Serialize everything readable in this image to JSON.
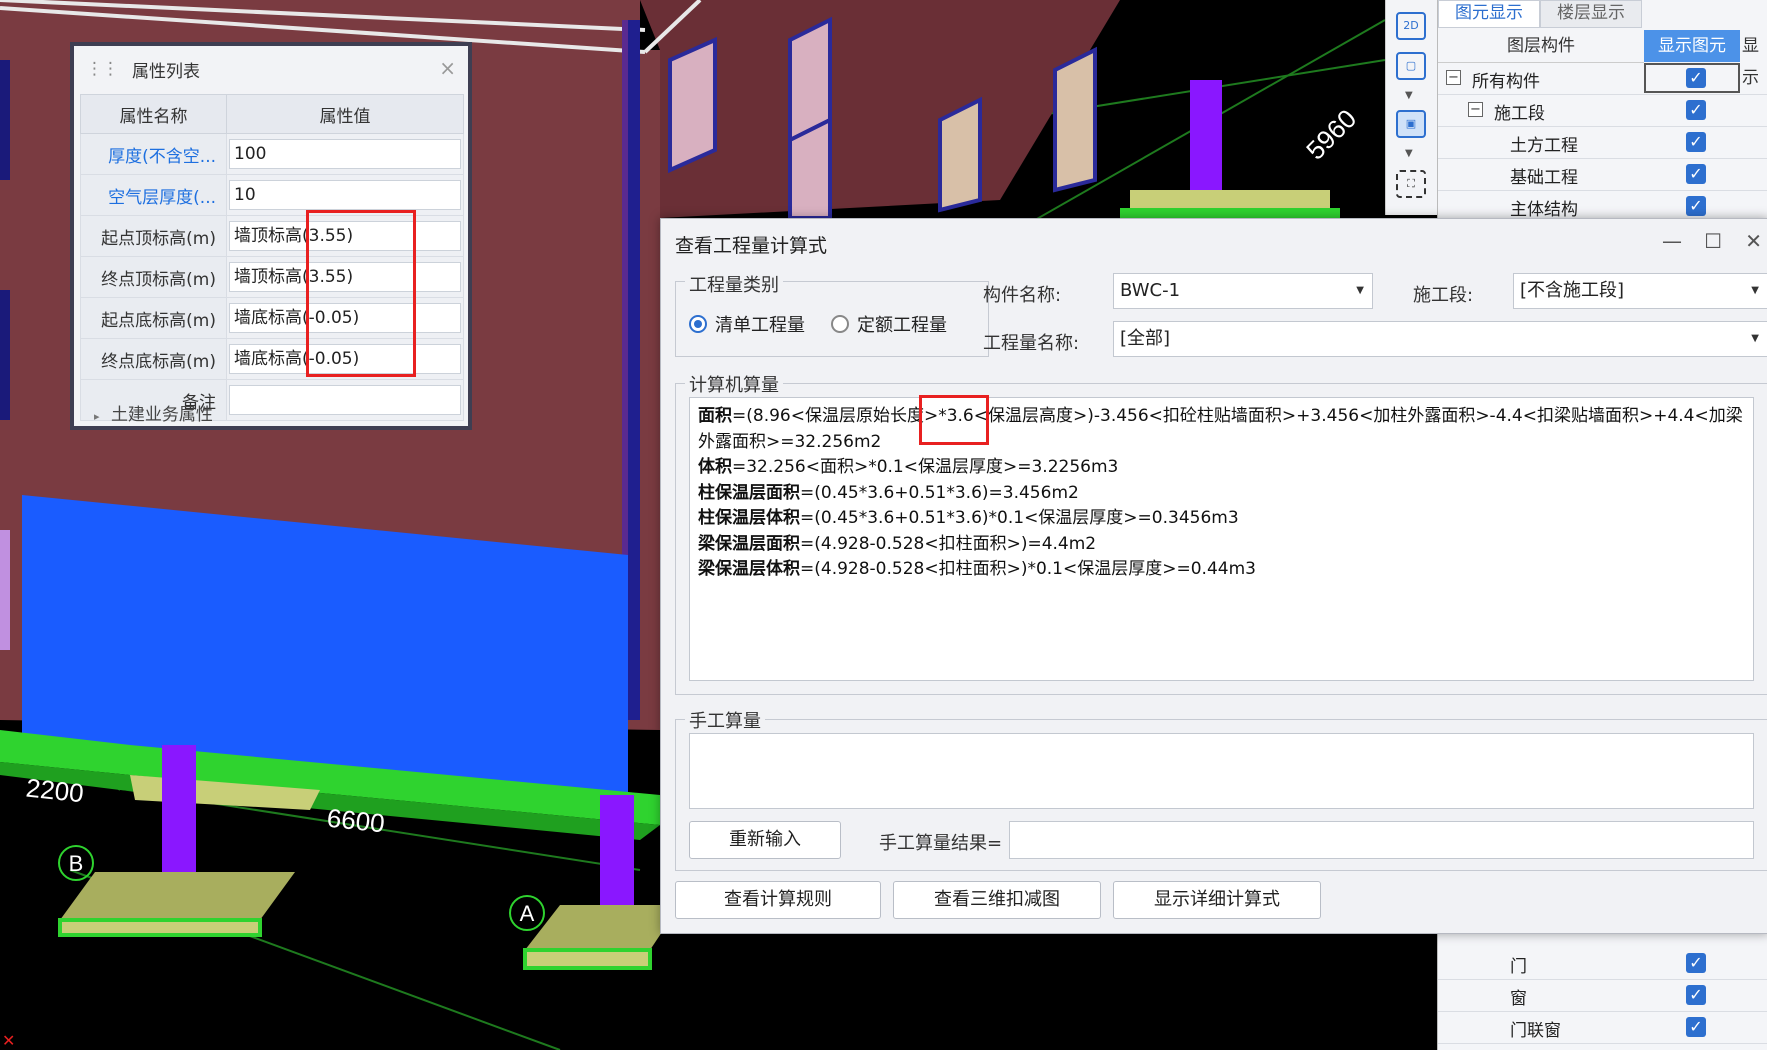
{
  "scene": {
    "dimensions": [
      "5960",
      "2200",
      "6600"
    ],
    "axis_labels": [
      "B",
      "A"
    ]
  },
  "property_panel": {
    "title": "属性列表",
    "close_glyph": "×",
    "header_name": "属性名称",
    "header_value": "属性值",
    "rows": [
      {
        "name": "厚度(不含空...",
        "value": "100"
      },
      {
        "name": "空气层厚度(...",
        "value": "10"
      },
      {
        "name": "起点顶标高(m)",
        "value": "墙顶标高(3.55)"
      },
      {
        "name": "终点顶标高(m)",
        "value": "墙顶标高(3.55)"
      },
      {
        "name": "起点底标高(m)",
        "value": "墙底标高(-0.05)"
      },
      {
        "name": "终点底标高(m)",
        "value": "墙底标高(-0.05)"
      },
      {
        "name": "备注",
        "value": ""
      }
    ],
    "footer_group": "土建业务属性",
    "blue_row_color": "#1d6fe0"
  },
  "toolstrip": {
    "tool_2d": "2D"
  },
  "layer_panel": {
    "tabs": [
      "图元显示",
      "楼层显示"
    ],
    "col_component": "图层构件",
    "col_show": "显示图元",
    "col_extra": "显示",
    "rows_top": [
      "所有构件",
      "施工段",
      "土方工程",
      "基础工程",
      "主体结构"
    ],
    "rows_bottom": [
      "门",
      "窗",
      "门联窗"
    ],
    "accent": "#4c92e8"
  },
  "dialog": {
    "title": "查看工程量计算式",
    "group_category": "工程量类别",
    "radio_list": "清单工程量",
    "radio_quota": "定额工程量",
    "label_component": "构件名称:",
    "component_value": "BWC-1",
    "label_stage": "施工段:",
    "stage_value": "[不含施工段]",
    "label_qty_name": "工程量名称:",
    "qty_name_value": "[全部]",
    "group_computer": "计算机算量",
    "formulas": [
      {
        "label": "面积",
        "expr": "=(8.96<保温层原始长度>*3.6<保温层高度>)-3.456<扣砼柱贴墙面积>+3.456<加柱外露面积>-4.4<扣梁贴墙面积>+4.4<加梁外露面积>=32.256m2"
      },
      {
        "label": "体积",
        "expr": "=32.256<面积>*0.1<保温层厚度>=3.2256m3"
      },
      {
        "label": "柱保温层面积",
        "expr": "=(0.45*3.6+0.51*3.6)=3.456m2"
      },
      {
        "label": "柱保温层体积",
        "expr": "=(0.45*3.6+0.51*3.6)*0.1<保温层厚度>=0.3456m3"
      },
      {
        "label": "梁保温层面积",
        "expr": "=(4.928-0.528<扣柱面积>)=4.4m2"
      },
      {
        "label": "梁保温层体积",
        "expr": "=(4.928-0.528<扣柱面积>)*0.1<保温层厚度>=0.44m3"
      }
    ],
    "group_manual": "手工算量",
    "btn_reenter": "重新输入",
    "label_manual_result": "手工算量结果=",
    "btn_rules": "查看计算规则",
    "btn_3d": "查看三维扣减图",
    "btn_detail": "显示详细计算式",
    "accent": "#2d6fcf"
  },
  "colors": {
    "wall": "#7a3b41",
    "insulation_blue": "#1a5cff",
    "slab_green": "#2fd32f",
    "column_purple": "#8a17ff",
    "footing": "#b5bd6a",
    "highlight_red": "#e82020"
  }
}
